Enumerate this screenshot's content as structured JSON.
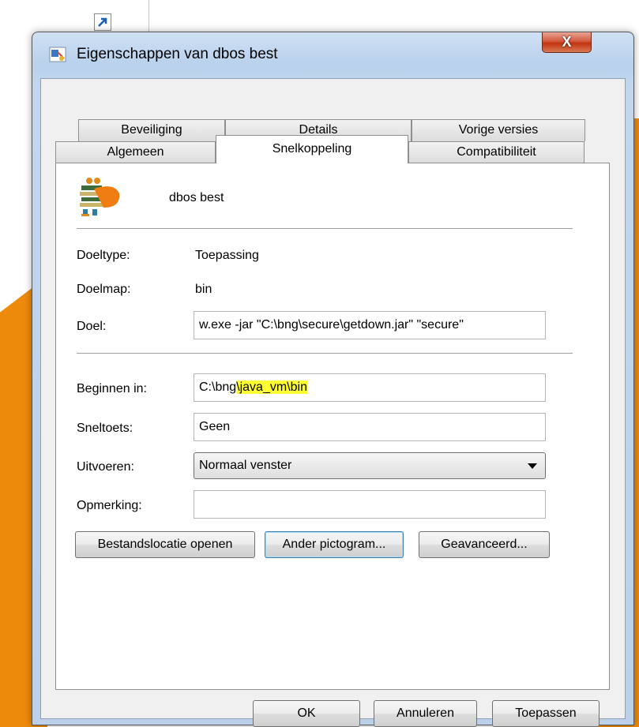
{
  "window": {
    "title": "Eigenschappen van dbos best",
    "close_label": "X"
  },
  "tabs": {
    "row1": [
      "Beveiliging",
      "Details",
      "Vorige versies"
    ],
    "row2": [
      "Algemeen",
      "Snelkoppeling",
      "Compatibiliteit"
    ],
    "active": "Snelkoppeling"
  },
  "shortcut": {
    "name": "dbos best",
    "doeltype_label": "Doeltype:",
    "doeltype_value": "Toepassing",
    "doelmap_label": "Doelmap:",
    "doelmap_value": "bin",
    "doel_label": "Doel:",
    "doel_value": "w.exe -jar \"C:\\bng\\secure\\getdown.jar\" \"secure\"",
    "beginnen_label": "Beginnen in:",
    "beginnen_prefix": "C:\\bng",
    "beginnen_highlight": "\\java_vm\\bin",
    "sneltoets_label": "Sneltoets:",
    "sneltoets_value": "Geen",
    "uitvoeren_label": "Uitvoeren:",
    "uitvoeren_value": "Normaal venster",
    "opmerking_label": "Opmerking:",
    "opmerking_value": ""
  },
  "actions": {
    "open_location": "Bestandslocatie openen",
    "change_icon": "Ander pictogram...",
    "advanced": "Geavanceerd..."
  },
  "footer": {
    "ok": "OK",
    "cancel": "Annuleren",
    "apply": "Toepassen"
  },
  "colors": {
    "highlight": "#ffff33",
    "desktop_accent": "#ee8a0b",
    "close_button": "#c2330f"
  }
}
